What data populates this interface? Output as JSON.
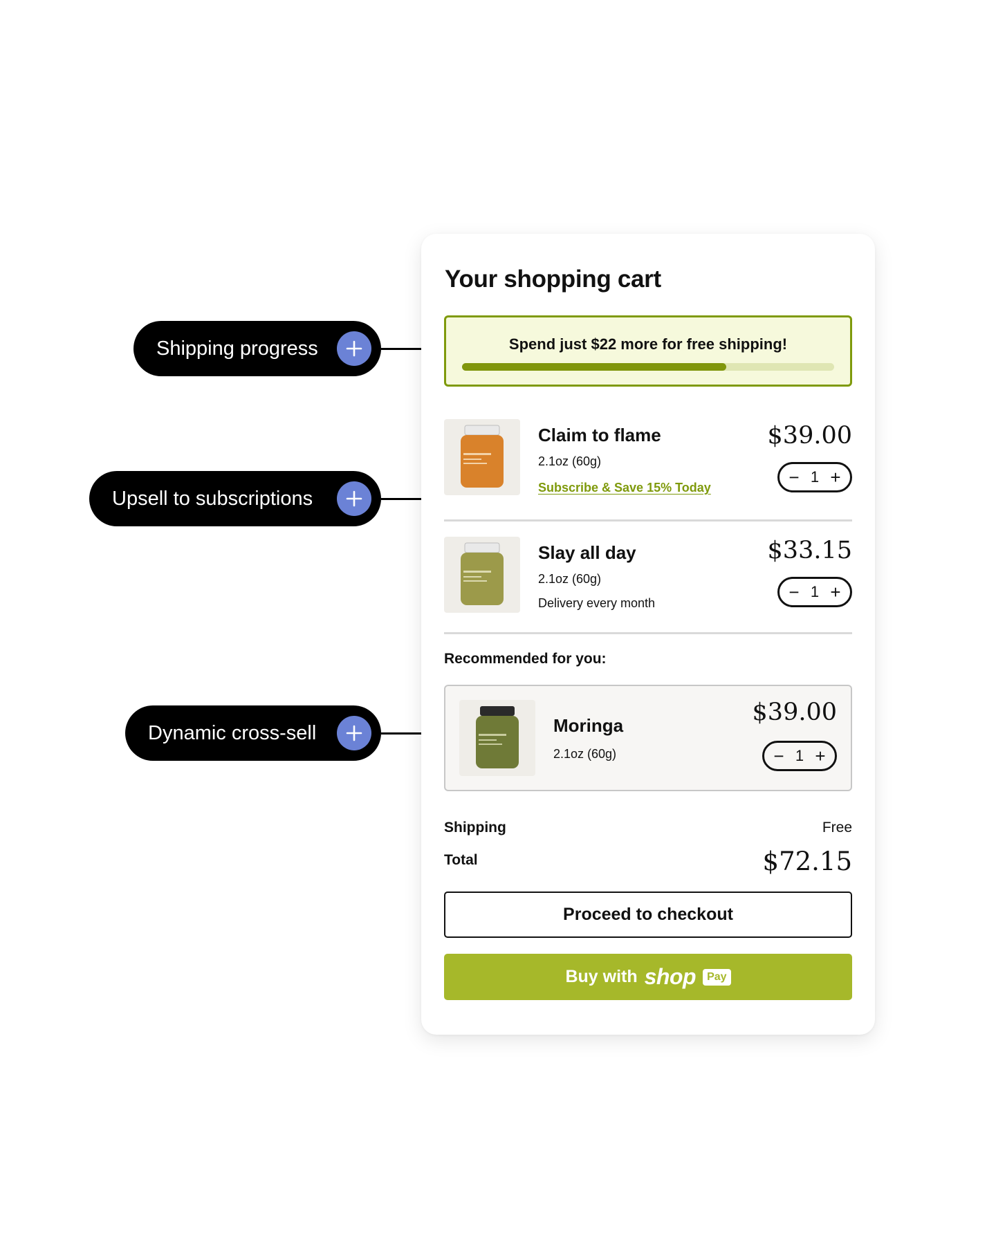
{
  "annotations": [
    {
      "label": "Shipping progress"
    },
    {
      "label": "Upsell to subscriptions"
    },
    {
      "label": "Dynamic cross-sell"
    }
  ],
  "cart": {
    "title": "Your shopping cart",
    "shipping_progress": {
      "message": "Spend just $22 more for free shipping!",
      "progress_fraction": 0.71,
      "fill_color": "#80960c",
      "track_color": "#dfe6b3"
    },
    "items": [
      {
        "name": "Claim to flame",
        "size": "2.1oz (60g)",
        "subscribe_link": "Subscribe & Save 15% Today",
        "price": "$39.00",
        "quantity": "1",
        "jar_color": "#d9822b",
        "jar_label": "Claim to Flame"
      },
      {
        "name": "Slay all day",
        "size": "2.1oz (60g)",
        "delivery": "Delivery every month",
        "price": "$33.15",
        "quantity": "1",
        "jar_color": "#9c9a4a",
        "jar_label": "Slay All Day"
      }
    ],
    "recommended": {
      "heading": "Recommended for you:",
      "item": {
        "name": "Moringa",
        "size": "2.1oz (60g)",
        "price": "$39.00",
        "quantity": "1",
        "jar_color": "#6f7a37",
        "jar_label": "Moringa"
      }
    },
    "summary": {
      "shipping_label": "Shipping",
      "shipping_value": "Free",
      "total_label": "Total",
      "total_value": "$72.15"
    },
    "checkout_label": "Proceed to checkout",
    "shop_pay": {
      "prefix": "Buy with",
      "brand": "shop",
      "badge": "Pay",
      "color": "#a6b82a"
    }
  },
  "stepper_icons": {
    "minus": "−",
    "plus": "+"
  }
}
